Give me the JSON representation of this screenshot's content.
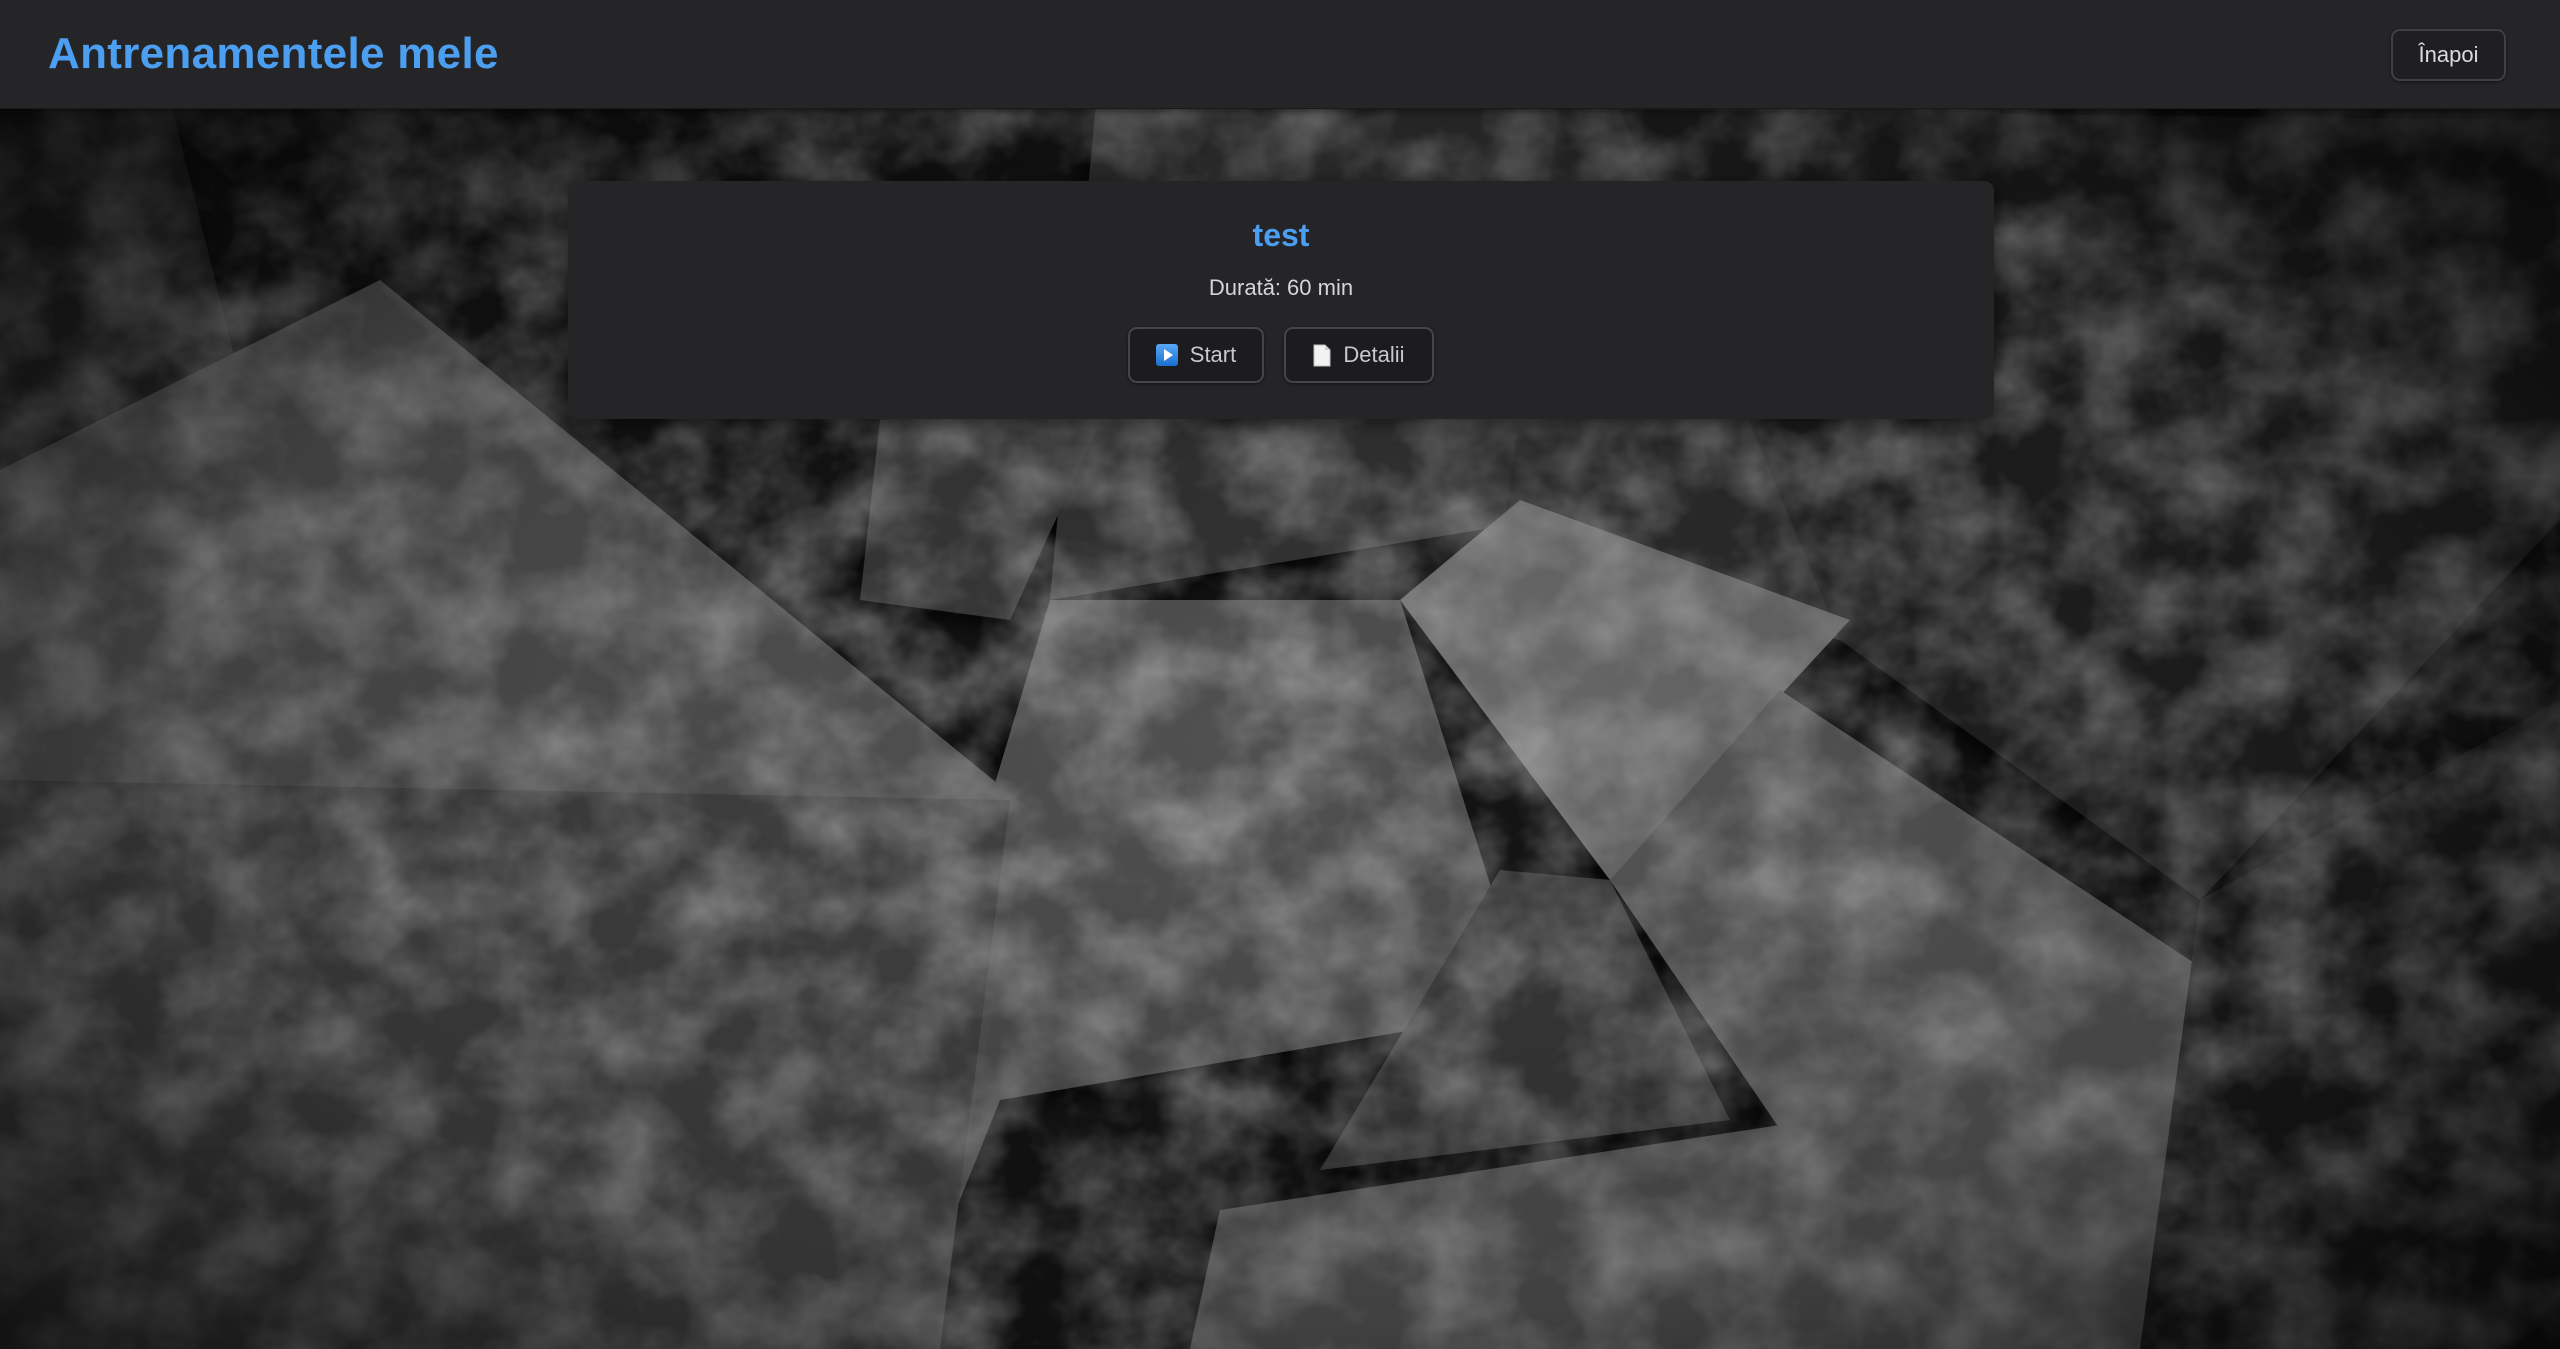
{
  "header": {
    "title": "Antrenamentele mele",
    "back_label": "Înapoi"
  },
  "workouts": [
    {
      "name": "test",
      "duration_label": "Durată:",
      "duration_value": "60 min",
      "start_label": "Start",
      "details_label": "Detalii",
      "start_icon": "play-button-icon",
      "details_icon": "document-icon"
    }
  ],
  "colors": {
    "accent": "#4c9ff0",
    "surface": "#252528",
    "text": "#d6d6d8"
  }
}
